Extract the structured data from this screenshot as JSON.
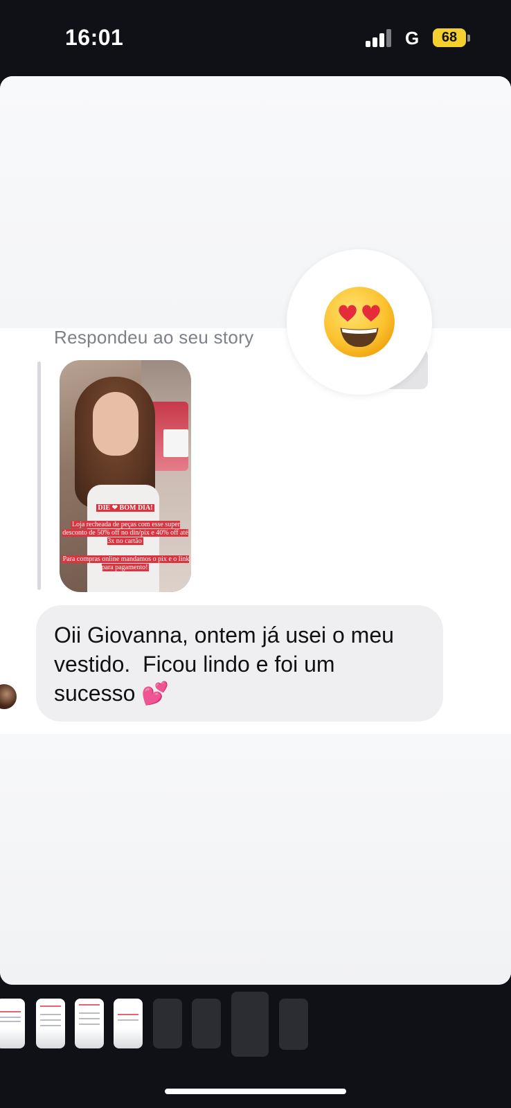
{
  "status_bar": {
    "time": "16:01",
    "network": "G",
    "battery": "68"
  },
  "thread": {
    "reply_label": "Respondeu ao seu story",
    "story_captions": {
      "line1": "DIE ❤ BOM DIA!",
      "line2": "Loja recheada de peças com esse super desconto de 50% off no din/pix e 40% off até 3x no cartão",
      "line3": "Para compras online mandamos o pix e o link para pagamento!"
    },
    "reaction_icon": "heart-eyes-emoji",
    "message": "Oii Giovanna, ontem já usei o meu\nvestido.  Ficou lindo e foi um\nsucesso 💕"
  },
  "colors": {
    "background": "#0f1117",
    "card": "#f6f7f9",
    "bubble": "#efeff2",
    "battery": "#f3d02e",
    "label": "#7d8089"
  }
}
